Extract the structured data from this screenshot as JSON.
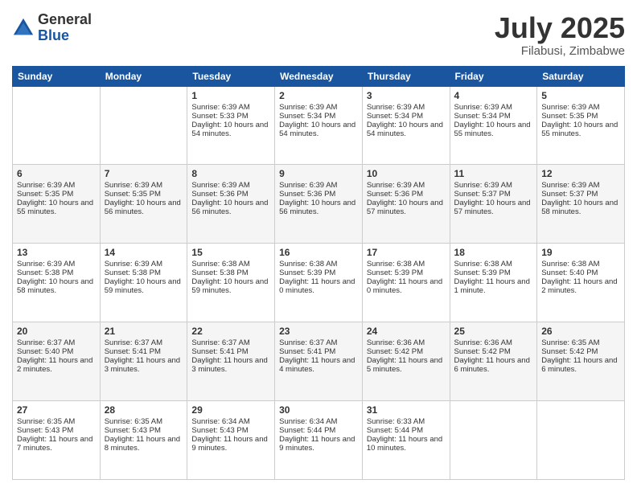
{
  "logo": {
    "general": "General",
    "blue": "Blue"
  },
  "header": {
    "month": "July 2025",
    "location": "Filabusi, Zimbabwe"
  },
  "weekdays": [
    "Sunday",
    "Monday",
    "Tuesday",
    "Wednesday",
    "Thursday",
    "Friday",
    "Saturday"
  ],
  "weeks": [
    [
      {
        "day": "",
        "info": ""
      },
      {
        "day": "",
        "info": ""
      },
      {
        "day": "1",
        "info": "Sunrise: 6:39 AM\nSunset: 5:33 PM\nDaylight: 10 hours and 54 minutes."
      },
      {
        "day": "2",
        "info": "Sunrise: 6:39 AM\nSunset: 5:34 PM\nDaylight: 10 hours and 54 minutes."
      },
      {
        "day": "3",
        "info": "Sunrise: 6:39 AM\nSunset: 5:34 PM\nDaylight: 10 hours and 54 minutes."
      },
      {
        "day": "4",
        "info": "Sunrise: 6:39 AM\nSunset: 5:34 PM\nDaylight: 10 hours and 55 minutes."
      },
      {
        "day": "5",
        "info": "Sunrise: 6:39 AM\nSunset: 5:35 PM\nDaylight: 10 hours and 55 minutes."
      }
    ],
    [
      {
        "day": "6",
        "info": "Sunrise: 6:39 AM\nSunset: 5:35 PM\nDaylight: 10 hours and 55 minutes."
      },
      {
        "day": "7",
        "info": "Sunrise: 6:39 AM\nSunset: 5:35 PM\nDaylight: 10 hours and 56 minutes."
      },
      {
        "day": "8",
        "info": "Sunrise: 6:39 AM\nSunset: 5:36 PM\nDaylight: 10 hours and 56 minutes."
      },
      {
        "day": "9",
        "info": "Sunrise: 6:39 AM\nSunset: 5:36 PM\nDaylight: 10 hours and 56 minutes."
      },
      {
        "day": "10",
        "info": "Sunrise: 6:39 AM\nSunset: 5:36 PM\nDaylight: 10 hours and 57 minutes."
      },
      {
        "day": "11",
        "info": "Sunrise: 6:39 AM\nSunset: 5:37 PM\nDaylight: 10 hours and 57 minutes."
      },
      {
        "day": "12",
        "info": "Sunrise: 6:39 AM\nSunset: 5:37 PM\nDaylight: 10 hours and 58 minutes."
      }
    ],
    [
      {
        "day": "13",
        "info": "Sunrise: 6:39 AM\nSunset: 5:38 PM\nDaylight: 10 hours and 58 minutes."
      },
      {
        "day": "14",
        "info": "Sunrise: 6:39 AM\nSunset: 5:38 PM\nDaylight: 10 hours and 59 minutes."
      },
      {
        "day": "15",
        "info": "Sunrise: 6:38 AM\nSunset: 5:38 PM\nDaylight: 10 hours and 59 minutes."
      },
      {
        "day": "16",
        "info": "Sunrise: 6:38 AM\nSunset: 5:39 PM\nDaylight: 11 hours and 0 minutes."
      },
      {
        "day": "17",
        "info": "Sunrise: 6:38 AM\nSunset: 5:39 PM\nDaylight: 11 hours and 0 minutes."
      },
      {
        "day": "18",
        "info": "Sunrise: 6:38 AM\nSunset: 5:39 PM\nDaylight: 11 hours and 1 minute."
      },
      {
        "day": "19",
        "info": "Sunrise: 6:38 AM\nSunset: 5:40 PM\nDaylight: 11 hours and 2 minutes."
      }
    ],
    [
      {
        "day": "20",
        "info": "Sunrise: 6:37 AM\nSunset: 5:40 PM\nDaylight: 11 hours and 2 minutes."
      },
      {
        "day": "21",
        "info": "Sunrise: 6:37 AM\nSunset: 5:41 PM\nDaylight: 11 hours and 3 minutes."
      },
      {
        "day": "22",
        "info": "Sunrise: 6:37 AM\nSunset: 5:41 PM\nDaylight: 11 hours and 3 minutes."
      },
      {
        "day": "23",
        "info": "Sunrise: 6:37 AM\nSunset: 5:41 PM\nDaylight: 11 hours and 4 minutes."
      },
      {
        "day": "24",
        "info": "Sunrise: 6:36 AM\nSunset: 5:42 PM\nDaylight: 11 hours and 5 minutes."
      },
      {
        "day": "25",
        "info": "Sunrise: 6:36 AM\nSunset: 5:42 PM\nDaylight: 11 hours and 6 minutes."
      },
      {
        "day": "26",
        "info": "Sunrise: 6:35 AM\nSunset: 5:42 PM\nDaylight: 11 hours and 6 minutes."
      }
    ],
    [
      {
        "day": "27",
        "info": "Sunrise: 6:35 AM\nSunset: 5:43 PM\nDaylight: 11 hours and 7 minutes."
      },
      {
        "day": "28",
        "info": "Sunrise: 6:35 AM\nSunset: 5:43 PM\nDaylight: 11 hours and 8 minutes."
      },
      {
        "day": "29",
        "info": "Sunrise: 6:34 AM\nSunset: 5:43 PM\nDaylight: 11 hours and 9 minutes."
      },
      {
        "day": "30",
        "info": "Sunrise: 6:34 AM\nSunset: 5:44 PM\nDaylight: 11 hours and 9 minutes."
      },
      {
        "day": "31",
        "info": "Sunrise: 6:33 AM\nSunset: 5:44 PM\nDaylight: 11 hours and 10 minutes."
      },
      {
        "day": "",
        "info": ""
      },
      {
        "day": "",
        "info": ""
      }
    ]
  ]
}
